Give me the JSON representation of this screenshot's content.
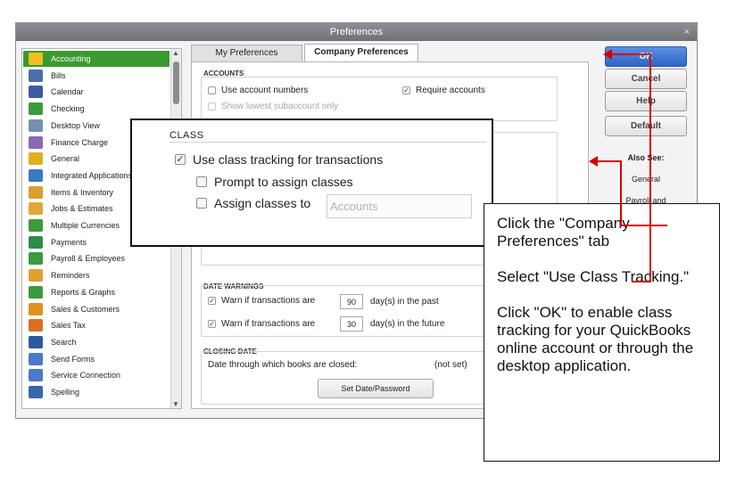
{
  "window": {
    "title": "Preferences",
    "close": "×"
  },
  "sidebar": {
    "items": [
      {
        "label": "Accounting",
        "color": "#f0c020",
        "icon": "pencil-book-icon"
      },
      {
        "label": "Bills",
        "color": "#4a6fa8",
        "icon": "bill-icon"
      },
      {
        "label": "Calendar",
        "color": "#3b5ca0",
        "icon": "calendar-icon"
      },
      {
        "label": "Checking",
        "color": "#3c9a3c",
        "icon": "checkbook-icon"
      },
      {
        "label": "Desktop View",
        "color": "#7a8fb0",
        "icon": "desktop-icon"
      },
      {
        "label": "Finance Charge",
        "color": "#8a6bb0",
        "icon": "percent-icon"
      },
      {
        "label": "General",
        "color": "#e0b020",
        "icon": "general-icon"
      },
      {
        "label": "Integrated Applications",
        "color": "#3a7ac0",
        "icon": "integrated-apps-icon"
      },
      {
        "label": "Items & Inventory",
        "color": "#d8a030",
        "icon": "boxes-icon"
      },
      {
        "label": "Jobs & Estimates",
        "color": "#e0a838",
        "icon": "jobs-icon"
      },
      {
        "label": "Multiple Currencies",
        "color": "#3c9a3c",
        "icon": "currency-icon"
      },
      {
        "label": "Payments",
        "color": "#2e8a4e",
        "icon": "payments-icon"
      },
      {
        "label": "Payroll & Employees",
        "color": "#3c9a3c",
        "icon": "payroll-icon"
      },
      {
        "label": "Reminders",
        "color": "#e0a030",
        "icon": "clock-icon"
      },
      {
        "label": "Reports & Graphs",
        "color": "#3c9a3c",
        "icon": "graph-icon"
      },
      {
        "label": "Sales & Customers",
        "color": "#e09020",
        "icon": "sales-icon"
      },
      {
        "label": "Sales Tax",
        "color": "#d87020",
        "icon": "sales-tax-icon"
      },
      {
        "label": "Search",
        "color": "#2a5a9a",
        "icon": "magnifier-icon"
      },
      {
        "label": "Send Forms",
        "color": "#4a7ac8",
        "icon": "send-forms-icon"
      },
      {
        "label": "Service Connection",
        "color": "#4a7ac8",
        "icon": "service-connection-icon"
      },
      {
        "label": "Spelling",
        "color": "#3a66b0",
        "icon": "spelling-icon"
      }
    ]
  },
  "tabs": {
    "my": "My Preferences",
    "company": "Company Preferences"
  },
  "accounts": {
    "title": "ACCOUNTS",
    "use_numbers": "Use account numbers",
    "show_lowest": "Show lowest subaccount only",
    "require": "Require accounts",
    "require_checked": "✓"
  },
  "date_warnings": {
    "title": "DATE WARNINGS",
    "past_label": "Warn if transactions are",
    "past_value": "90",
    "past_suffix": "day(s) in the past",
    "future_label": "Warn if transactions are",
    "future_value": "30",
    "future_suffix": "day(s) in the future",
    "check": "✓"
  },
  "closing_date": {
    "title": "CLOSING DATE",
    "label": "Date through which books are closed:",
    "value": "(not set)",
    "button": "Set Date/Password"
  },
  "buttons": {
    "ok": "OK",
    "cancel": "Cancel",
    "help": "Help",
    "default": "Default"
  },
  "also_see": {
    "title": "Also See:",
    "items": [
      "General",
      "Payroll and"
    ]
  },
  "class_callout": {
    "title": "CLASS",
    "use_tracking": "Use class tracking for transactions",
    "check": "✓",
    "prompt": "Prompt to assign classes",
    "assign": "Assign classes to",
    "assign_value": "Accounts"
  },
  "instructions": {
    "p1": "Click the \"Company Preferences\" tab",
    "p2": "Select \"Use Class Tracking.\"",
    "p3": "Click \"OK\" to enable class tracking for your QuickBooks online account or through the desktop application."
  },
  "colors": {
    "accent_red": "#d40000",
    "selected_green": "#3a9a2e",
    "ok_blue": "#2f66c7"
  }
}
